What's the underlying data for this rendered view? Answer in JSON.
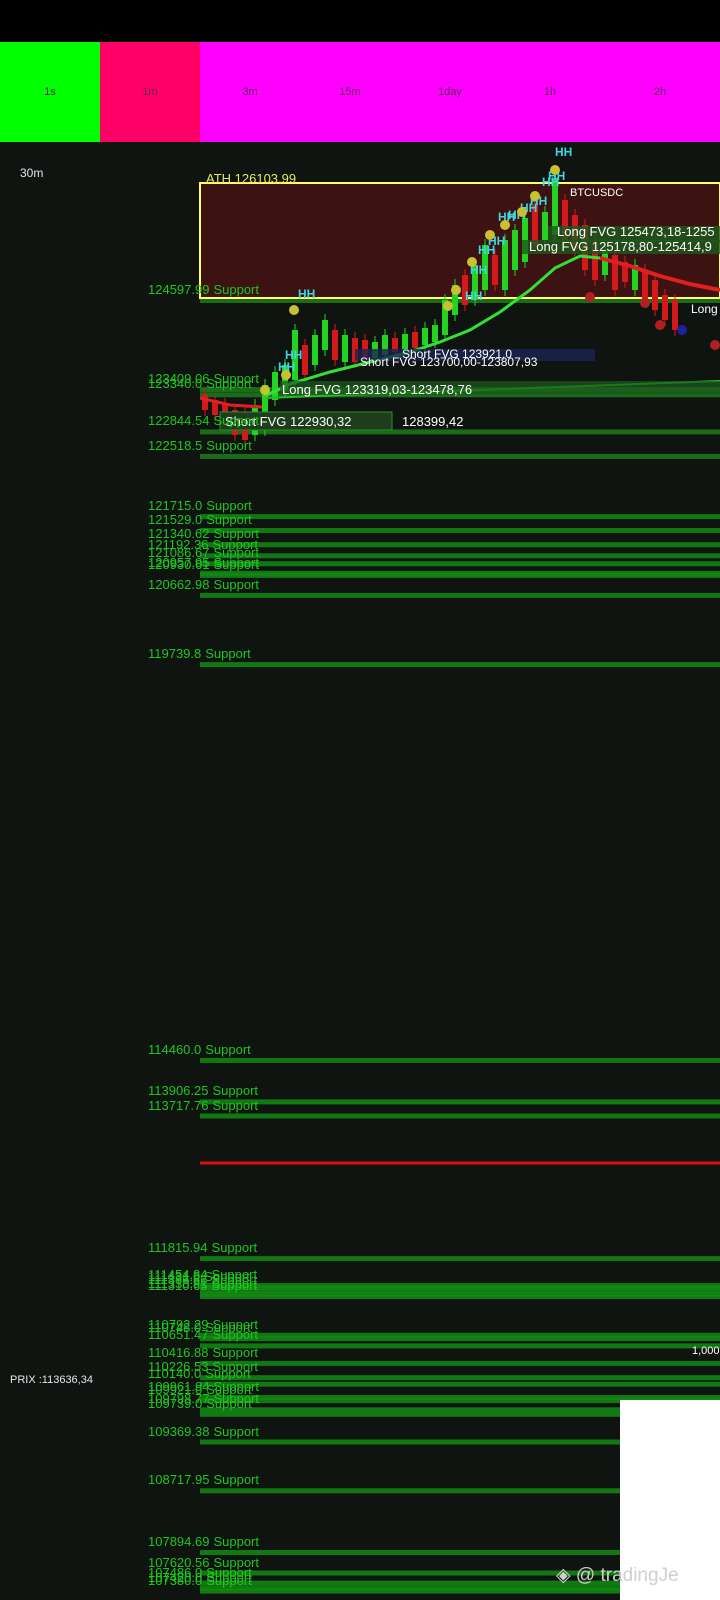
{
  "timeframes": [
    {
      "label": "1s",
      "color": "#00ff00"
    },
    {
      "label": "1m",
      "color": "#ff0066"
    },
    {
      "label": "3m",
      "color": "#ff00ff"
    },
    {
      "label": "15m",
      "color": "#ff00ff"
    },
    {
      "label": "1day",
      "color": "#ff00ff"
    },
    {
      "label": "1h",
      "color": "#ff00ff"
    },
    {
      "label": "2h",
      "color": "#ff00ff"
    }
  ],
  "interval_label": "30m",
  "ath_label": "ATH 126103.99",
  "symbol": "BTCUSDC",
  "price_label": "PRIX :113636,34",
  "right_value": "1,000",
  "watermark": "@ tradingJe",
  "fvg_labels": [
    "Long FVG 125473,18-1255",
    "Long FVG 125178,80-125414,9",
    "Short FVG 123700,00-123807,93",
    "Short FVG 123921,0",
    "Long FVG 123319,03-123478,76",
    "Short FVG 122930,32",
    "128399,42",
    "Long"
  ],
  "swing_labels": [
    "HH",
    "HH",
    "HH",
    "HH",
    "HH",
    "HH",
    "HH",
    "HH",
    "HH",
    "HH",
    "HH",
    "HH",
    "HH",
    "HH"
  ],
  "support_suffix": "Support",
  "supports": [
    "124597.99",
    "123409.06",
    "123340.0",
    "122844.54",
    "122518.5",
    "121715.0",
    "121529.0",
    "121340.62",
    "121192.36",
    "121086.67",
    "120957.95",
    "120930.61",
    "120662.98",
    "119739.8",
    "114460.0",
    "113906.25",
    "113717.76",
    "111815.94",
    "111454.84",
    "111431.0",
    "111386.66",
    "111338.91",
    "111310.65",
    "110792.29",
    "110748.0",
    "110651.47",
    "110416.88",
    "110226.53",
    "110140.0",
    "109961.94",
    "109921.0",
    "109798.77",
    "109739.0",
    "109369.38",
    "108717.95",
    "107894.69",
    "107620.56",
    "107486.0",
    "107420.0",
    "107380.0"
  ],
  "colors": {
    "support": "#1ec71e",
    "ath_box": "#ffff66",
    "zone_fill": "#3d1212",
    "ema_green": "#33e033",
    "ema_red": "#e02020",
    "price_line": "#e01010",
    "swing": "#3fd6e0"
  },
  "chart_data": {
    "type": "candlestick",
    "symbol": "BTCUSDC",
    "interval": "30m",
    "ath": 126103.99,
    "current_price": 113636.34,
    "support_levels": [
      124597.99,
      123409.06,
      123340.0,
      122844.54,
      122518.5,
      121715.0,
      121529.0,
      121340.62,
      121192.36,
      121086.67,
      120957.95,
      120930.61,
      120662.98,
      119739.8,
      114460.0,
      113906.25,
      113717.76,
      111815.94,
      111454.84,
      111431.0,
      111386.66,
      111338.91,
      111310.65,
      110792.29,
      110748.0,
      110651.47,
      110416.88,
      110226.53,
      110140.0,
      109961.94,
      109921.0,
      109798.77,
      109739.0,
      109369.38,
      108717.95,
      107894.69,
      107620.56,
      107486.0,
      107420.0,
      107380.0
    ]
  }
}
